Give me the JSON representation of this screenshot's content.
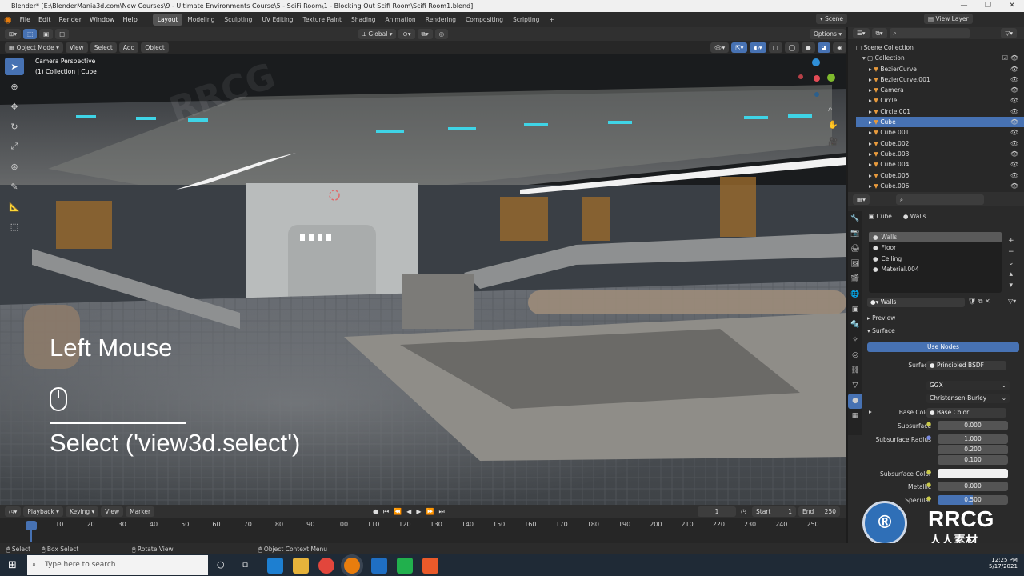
{
  "window": {
    "title": "Blender* [E:\\BlenderMania3d.com\\New Courses\\9 - Ultimate Environments Course\\5 - SciFi Room\\1 - Blocking Out Scifi Room\\Scifi Room1.blend]"
  },
  "menu": [
    "File",
    "Edit",
    "Render",
    "Window",
    "Help"
  ],
  "workspaces": [
    "Layout",
    "Modeling",
    "Sculpting",
    "UV Editing",
    "Texture Paint",
    "Shading",
    "Animation",
    "Rendering",
    "Compositing",
    "Scripting"
  ],
  "topright": {
    "scene": "Scene",
    "view_layer": "View Layer"
  },
  "viewport_header": {
    "mode": "Object Mode",
    "menus": [
      "View",
      "Select",
      "Add",
      "Object"
    ],
    "transform": "Global",
    "options": "Options"
  },
  "viewport": {
    "camera_label": "Camera Perspective",
    "collection_label": "(1) Collection | Cube",
    "overlay_title": "Left Mouse",
    "overlay_action": "Select ('view3d.select')"
  },
  "outliner": {
    "root": "Scene Collection",
    "collection": "Collection",
    "items": [
      {
        "name": "BezierCurve",
        "selected": false
      },
      {
        "name": "BezierCurve.001",
        "selected": false
      },
      {
        "name": "Camera",
        "selected": false
      },
      {
        "name": "Circle",
        "selected": false
      },
      {
        "name": "Circle.001",
        "selected": false
      },
      {
        "name": "Cube",
        "selected": true
      },
      {
        "name": "Cube.001",
        "selected": false
      },
      {
        "name": "Cube.002",
        "selected": false
      },
      {
        "name": "Cube.003",
        "selected": false
      },
      {
        "name": "Cube.004",
        "selected": false
      },
      {
        "name": "Cube.005",
        "selected": false
      },
      {
        "name": "Cube.006",
        "selected": false
      }
    ]
  },
  "properties": {
    "object": "Cube",
    "material": "Walls",
    "slots": [
      "Walls",
      "Floor",
      "Ceiling",
      "Material.004"
    ],
    "material_name": "Walls",
    "preview": "Preview",
    "surface_panel": "Surface",
    "use_nodes": "Use Nodes",
    "surface_label": "Surface",
    "surface_value": "Principled BSDF",
    "distribution": "GGX",
    "subsurface_method": "Christensen-Burley",
    "base_color_label": "Base Color",
    "base_color_value": "Base Color",
    "subsurface_label": "Subsurface",
    "subsurface_value": "0.000",
    "subsurface_radius_label": "Subsurface Radius",
    "subsurface_radius": [
      "1.000",
      "0.200",
      "0.100"
    ],
    "subsurface_color_label": "Subsurface Color",
    "metallic_label": "Metallic",
    "metallic_value": "0.000",
    "specular_label": "Specular",
    "specular_value": "0.500"
  },
  "timeline": {
    "menus": [
      "Playback",
      "Keying",
      "View",
      "Marker"
    ],
    "current_frame": "1",
    "start_label": "Start",
    "start": "1",
    "end_label": "End",
    "end": "250",
    "ticks": [
      "1",
      "10",
      "20",
      "30",
      "40",
      "50",
      "60",
      "70",
      "80",
      "90",
      "100",
      "110",
      "120",
      "130",
      "140",
      "150",
      "160",
      "170",
      "180",
      "190",
      "200",
      "210",
      "220",
      "230",
      "240",
      "250"
    ]
  },
  "statusbar": {
    "select": "Select",
    "box_select": "Box Select",
    "rotate_view": "Rotate View",
    "context_menu": "Object Context Menu"
  },
  "taskbar": {
    "search_placeholder": "Type here to search",
    "time": "12:25 PM",
    "date": "5/17/2021"
  },
  "watermark": {
    "brand": "RRCG",
    "sub": "人人素材"
  },
  "colors": {
    "accent": "#4772b3",
    "panel": "#303030",
    "bg": "#1d1d1d",
    "taskbar": "#1f2a36"
  }
}
